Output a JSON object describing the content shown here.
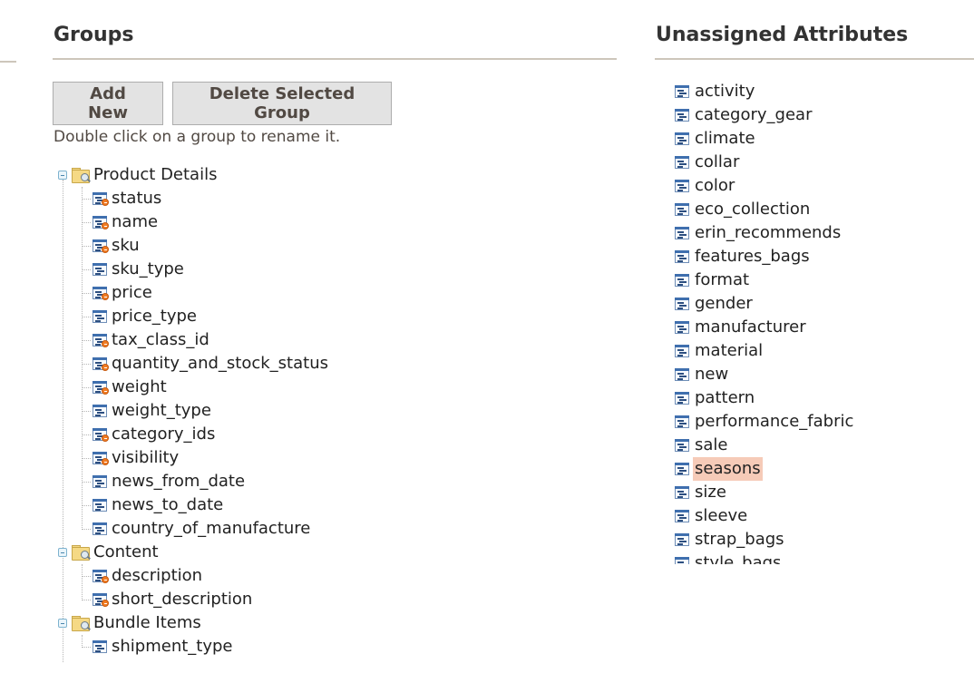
{
  "groups": {
    "title": "Groups",
    "add_label": "Add New",
    "delete_label": "Delete Selected Group",
    "hint": "Double click on a group to rename it.",
    "tree": [
      {
        "name": "Product Details",
        "children": [
          {
            "name": "status",
            "locked": true
          },
          {
            "name": "name",
            "locked": true
          },
          {
            "name": "sku",
            "locked": true
          },
          {
            "name": "sku_type",
            "locked": false
          },
          {
            "name": "price",
            "locked": true
          },
          {
            "name": "price_type",
            "locked": false
          },
          {
            "name": "tax_class_id",
            "locked": true
          },
          {
            "name": "quantity_and_stock_status",
            "locked": true
          },
          {
            "name": "weight",
            "locked": true
          },
          {
            "name": "weight_type",
            "locked": false
          },
          {
            "name": "category_ids",
            "locked": true
          },
          {
            "name": "visibility",
            "locked": true
          },
          {
            "name": "news_from_date",
            "locked": false
          },
          {
            "name": "news_to_date",
            "locked": false
          },
          {
            "name": "country_of_manufacture",
            "locked": false
          }
        ]
      },
      {
        "name": "Content",
        "children": [
          {
            "name": "description",
            "locked": true
          },
          {
            "name": "short_description",
            "locked": true
          }
        ]
      },
      {
        "name": "Bundle Items",
        "children": [
          {
            "name": "shipment_type",
            "locked": false
          }
        ]
      }
    ]
  },
  "unassigned": {
    "title": "Unassigned Attributes",
    "selected": "seasons",
    "items": [
      "activity",
      "category_gear",
      "climate",
      "collar",
      "color",
      "eco_collection",
      "erin_recommends",
      "features_bags",
      "format",
      "gender",
      "manufacturer",
      "material",
      "new",
      "pattern",
      "performance_fabric",
      "sale",
      "seasons",
      "size",
      "sleeve",
      "strap_bags",
      "style_bags"
    ]
  }
}
